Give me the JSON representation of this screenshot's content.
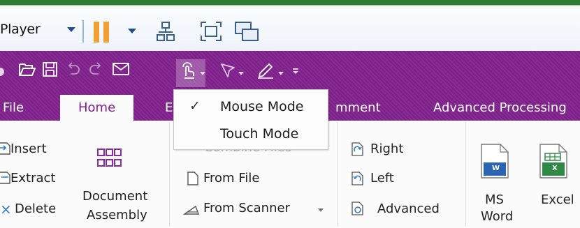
{
  "player_bar": {
    "label": "Player",
    "icons": [
      "pause-icon",
      "network-icon",
      "fullscreen-icon",
      "window-switch-icon"
    ]
  },
  "quick_access": {
    "icons": [
      "open-folder-icon",
      "save-icon",
      "undo-icon",
      "redo-icon",
      "email-icon",
      "touch-mode-icon",
      "stamp-icon",
      "pen-icon",
      "customize-icon"
    ]
  },
  "tabs": [
    {
      "label": "File"
    },
    {
      "label": "Home",
      "active": true
    },
    {
      "label": "E"
    },
    {
      "label": "mment"
    },
    {
      "label": "Advanced Processing"
    }
  ],
  "ribbon": {
    "pages_group": {
      "insert": "Insert",
      "extract": "Extract",
      "delete": "Delete",
      "document_assembly_line1": "Document",
      "document_assembly_line2": "Assembly"
    },
    "create_group": {
      "combine_files": "Combine Files",
      "from_file": "From File",
      "from_scanner": "From Scanner"
    },
    "rotate_group": {
      "right": "Right",
      "left": "Left",
      "advanced": "Advanced"
    },
    "export_group": {
      "ms_word_line1": "MS",
      "ms_word_line2": "Word",
      "word_badge": "W",
      "excel": "Excel",
      "excel_badge": "X"
    }
  },
  "mode_menu": {
    "items": [
      {
        "label": "Mouse Mode",
        "check": "✓"
      },
      {
        "label": "Touch Mode",
        "check": ""
      }
    ]
  },
  "colors": {
    "accent_purple": "#80218c",
    "pause_orange": "#f0a033",
    "player_blue": "#1e4f8c"
  }
}
